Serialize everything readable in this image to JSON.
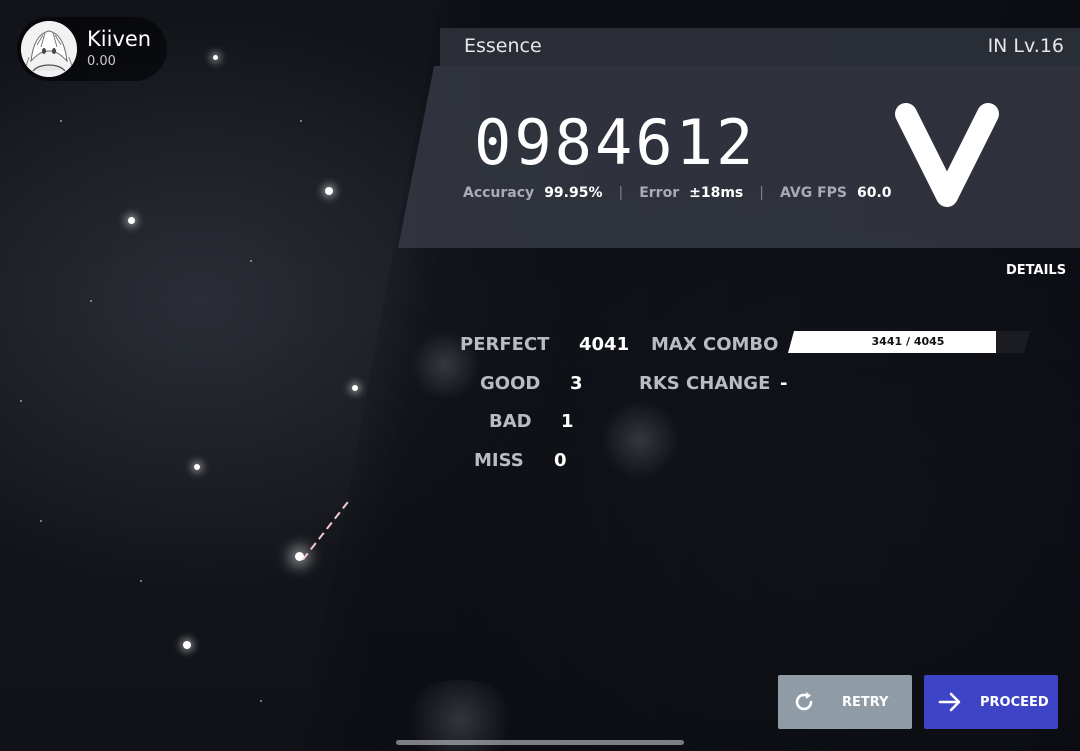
{
  "player": {
    "name": "Kiiven",
    "rks": "0.00"
  },
  "song": {
    "title": "Essence",
    "difficulty": "IN Lv.16"
  },
  "result": {
    "score": "0984612",
    "grade": "V",
    "accuracy_label": "Accuracy",
    "accuracy_value": "99.95%",
    "error_label": "Error",
    "error_value": "±18ms",
    "fps_label": "AVG FPS",
    "fps_value": "60.0"
  },
  "details_label": "DETAILS",
  "judgements": {
    "perfect_label": "PERFECT",
    "perfect_value": "4041",
    "good_label": "GOOD",
    "good_value": "3",
    "bad_label": "BAD",
    "bad_value": "1",
    "miss_label": "MISS",
    "miss_value": "0"
  },
  "combo": {
    "label": "MAX COMBO",
    "text": "3441 / 4045",
    "max": 3441,
    "total": 4045
  },
  "rks_change": {
    "label": "RKS CHANGE",
    "value": "-"
  },
  "buttons": {
    "retry_label": "RETRY",
    "retry_icon": "retry-icon",
    "proceed_label": "PROCEED",
    "proceed_icon": "arrow-right-icon"
  },
  "colors": {
    "proceed_button": "#3d44c6",
    "retry_button": "#8f9ca6"
  }
}
